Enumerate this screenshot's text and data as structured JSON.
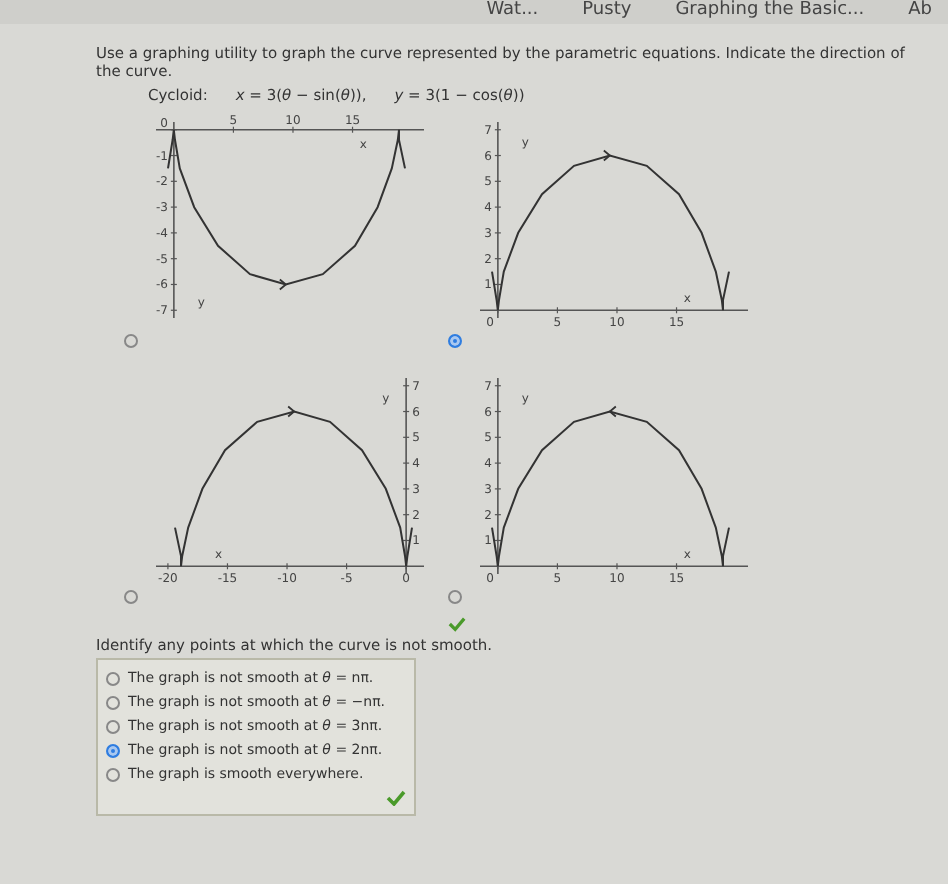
{
  "browser_tabs": [
    {
      "label": "Wat..."
    },
    {
      "label": "Pusty"
    },
    {
      "label": "Graphing the Basic..."
    },
    {
      "label": "Ab"
    }
  ],
  "question": {
    "prompt": "Use a graphing utility to graph the curve represented by the parametric equations. Indicate the direction of the curve.",
    "equation_label": "Cycloid:",
    "equations": [
      "*x* = 3(*θ* − sin(*θ*)),",
      "*y* = 3(1 − cos(*θ*))"
    ]
  },
  "graphs": [
    {
      "selected": false,
      "chart_data": {
        "type": "line",
        "xlabel": "x",
        "ylabel": "y",
        "x": [
          -0.5,
          -0.1,
          0,
          0.1,
          0.5,
          1.7,
          3.7,
          6.4,
          9.4,
          12.5,
          15.2,
          17.1,
          18.3,
          18.8,
          18.9,
          18.9,
          19.4
        ],
        "series": [
          {
            "color": "#333333",
            "values": [
              -1.5,
              -0.4,
              0,
              -0.4,
              -1.5,
              -3,
              -4.5,
              -5.6,
              -6,
              -5.6,
              -4.5,
              -3,
              -1.5,
              -0.4,
              0,
              -0.4,
              -1.5
            ]
          }
        ],
        "xlim": [
          -1.5,
          21
        ],
        "ylim": [
          -7.3,
          0.3
        ],
        "xticks": [
          5,
          10,
          15
        ],
        "yticks": [
          0,
          -1,
          -2,
          -3,
          -4,
          -5,
          -6,
          -7
        ]
      }
    },
    {
      "selected": true,
      "chart_data": {
        "type": "line",
        "xlabel": "x",
        "ylabel": "y",
        "x": [
          -0.5,
          -0.1,
          0,
          0.1,
          0.5,
          1.7,
          3.7,
          6.4,
          9.4,
          12.5,
          15.2,
          17.1,
          18.3,
          18.8,
          18.9,
          18.9,
          19.4
        ],
        "series": [
          {
            "color": "#333333",
            "values": [
              1.5,
              0.4,
              0,
              0.4,
              1.5,
              3,
              4.5,
              5.6,
              6,
              5.6,
              4.5,
              3,
              1.5,
              0.4,
              0,
              0.4,
              1.5
            ]
          }
        ],
        "xlim": [
          -1.5,
          21
        ],
        "ylim": [
          -0.3,
          7.3
        ],
        "xticks": [
          0,
          5,
          10,
          15
        ],
        "yticks": [
          1,
          2,
          3,
          4,
          5,
          6,
          7
        ]
      }
    },
    {
      "selected": false,
      "chart_data": {
        "type": "line",
        "xlabel": "x",
        "ylabel": "y",
        "x": [
          -19.4,
          -18.9,
          -18.9,
          -18.8,
          -18.3,
          -17.1,
          -15.2,
          -12.5,
          -9.4,
          -6.4,
          -3.7,
          -1.7,
          -0.5,
          -0.1,
          0,
          0.1,
          0.5
        ],
        "series": [
          {
            "color": "#333333",
            "values": [
              1.5,
              0.4,
              0,
              0.4,
              1.5,
              3,
              4.5,
              5.6,
              6,
              5.6,
              4.5,
              3,
              1.5,
              0.4,
              0,
              0.4,
              1.5
            ]
          }
        ],
        "xlim": [
          -21,
          1.5
        ],
        "ylim": [
          -0.3,
          7.3
        ],
        "xticks": [
          -20,
          -15,
          -10,
          -5,
          0
        ],
        "yticks": [
          1,
          2,
          3,
          4,
          5,
          6,
          7
        ]
      }
    },
    {
      "selected": false,
      "correct": true,
      "chart_data": {
        "type": "line",
        "xlabel": "x",
        "ylabel": "y",
        "x": [
          19.4,
          18.9,
          18.9,
          18.8,
          18.3,
          17.1,
          15.2,
          12.5,
          9.4,
          6.4,
          3.7,
          1.7,
          0.5,
          0.1,
          0,
          -0.1,
          -0.5
        ],
        "series": [
          {
            "color": "#333333",
            "values": [
              1.5,
              0.4,
              0,
              0.4,
              1.5,
              3,
              4.5,
              5.6,
              6,
              5.6,
              4.5,
              3,
              1.5,
              0.4,
              0,
              0.4,
              1.5
            ]
          }
        ],
        "xlim": [
          -1.5,
          21
        ],
        "ylim": [
          -0.3,
          7.3
        ],
        "xticks": [
          0,
          5,
          10,
          15
        ],
        "yticks": [
          1,
          2,
          3,
          4,
          5,
          6,
          7
        ]
      }
    }
  ],
  "smoothness": {
    "prompt": "Identify any points at which the curve is not smooth.",
    "correct": true,
    "options": [
      {
        "label": "The graph is not smooth at *θ* = nπ.",
        "selected": false
      },
      {
        "label": "The graph is not smooth at *θ* = −nπ.",
        "selected": false
      },
      {
        "label": "The graph is not smooth at *θ* = 3nπ.",
        "selected": false
      },
      {
        "label": "The graph is not smooth at *θ* = 2nπ.",
        "selected": true
      },
      {
        "label": "The graph is smooth everywhere.",
        "selected": false
      }
    ]
  }
}
